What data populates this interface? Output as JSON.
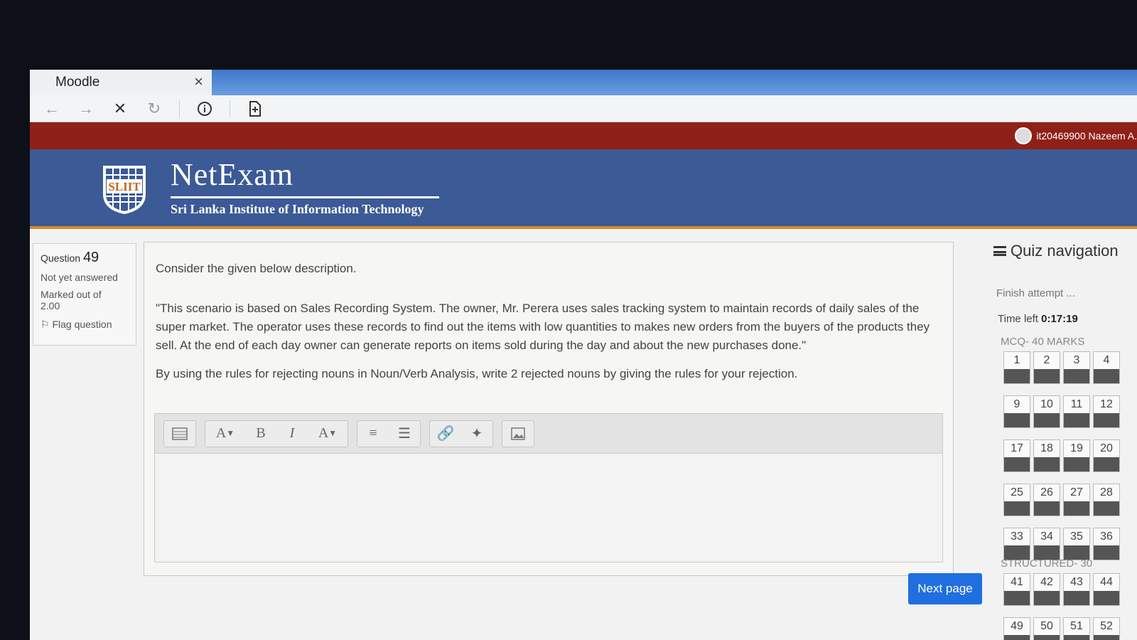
{
  "browser": {
    "tab_title": "Moodle",
    "tab_close": "×",
    "icons": [
      "back-icon",
      "forward-icon",
      "stop-icon",
      "reload-icon",
      "info-icon",
      "reader-icon"
    ]
  },
  "user": {
    "name": "it20469900 Nazeem A."
  },
  "header": {
    "title": "NetExam",
    "subtitle": "Sri Lanka Institute of Information Technology",
    "logo_text": "SLIIT"
  },
  "question_info": {
    "label": "Question",
    "number": "49",
    "status": "Not yet answered",
    "marks_label": "Marked out of",
    "marks": "2.00",
    "flag_label": "Flag question"
  },
  "question": {
    "intro": "Consider the given below description.",
    "scenario": "\"This scenario is based on Sales Recording System.  The owner, Mr. Perera uses sales tracking system to maintain records of daily sales of the super market. The operator uses these records to find out the items with low quantities to makes new orders from the buyers of the products they sell. At the end of each day owner can generate reports on items sold during the day and about the new purchases done.\"",
    "prompt": "By using the rules for rejecting nouns in Noun/Verb Analysis, write 2 rejected nouns by giving the rules for your rejection."
  },
  "editor": {
    "buttons": {
      "format": "A",
      "bold": "B",
      "italic": "I",
      "color": "A"
    },
    "value": ""
  },
  "next_button": "Next page",
  "quiz_nav": {
    "title": "Quiz navigation",
    "finish": "Finish attempt ...",
    "time_label": "Time left",
    "time_value": "0:17:19",
    "mcq_label": "MCQ- 40 MARKS",
    "mcq_numbers": [
      "1",
      "2",
      "3",
      "4",
      "9",
      "10",
      "11",
      "12",
      "17",
      "18",
      "19",
      "20",
      "25",
      "26",
      "27",
      "28",
      "33",
      "34",
      "35",
      "36"
    ],
    "structured_label": "STRUCTURED- 30",
    "structured_numbers": [
      "41",
      "42",
      "43",
      "44",
      "49",
      "50",
      "51",
      "52"
    ]
  },
  "colors": {
    "user_bar": "#8f2018",
    "header": "#3b5a96",
    "accent": "#d68b2a",
    "next_button": "#1f6fe0"
  }
}
